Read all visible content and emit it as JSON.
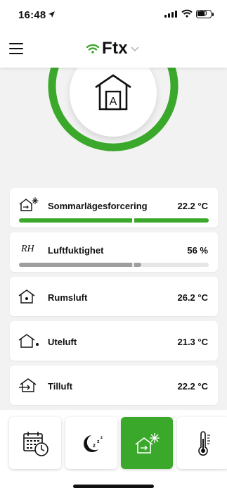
{
  "status_bar": {
    "time": "16:48",
    "battery": "50"
  },
  "header": {
    "brand": "Ftx"
  },
  "hero": {
    "mode_letter": "A"
  },
  "readings": {
    "summer": {
      "label": "Sommarlägesforcering",
      "value": "22.2 °C",
      "progress": 1.0
    },
    "humidity": {
      "abbr": "RH",
      "label": "Luftfuktighet",
      "value": "56 %",
      "progress": 0.65
    },
    "room": {
      "label": "Rumsluft",
      "value": "26.2 °C"
    },
    "outdoor": {
      "label": "Uteluft",
      "value": "21.3 °C"
    },
    "supply": {
      "label": "Tilluft",
      "value": "22.2 °C"
    }
  },
  "tabs": [
    {
      "icon": "calendar-clock-icon",
      "active": false
    },
    {
      "icon": "night-sleep-icon",
      "active": false
    },
    {
      "icon": "summer-mode-icon",
      "active": true
    },
    {
      "icon": "thermometer-icon",
      "active": false
    }
  ],
  "colors": {
    "accent": "#3aa82a",
    "bar_gray": "#9e9e9e",
    "track_gray": "#e6e6e6"
  }
}
